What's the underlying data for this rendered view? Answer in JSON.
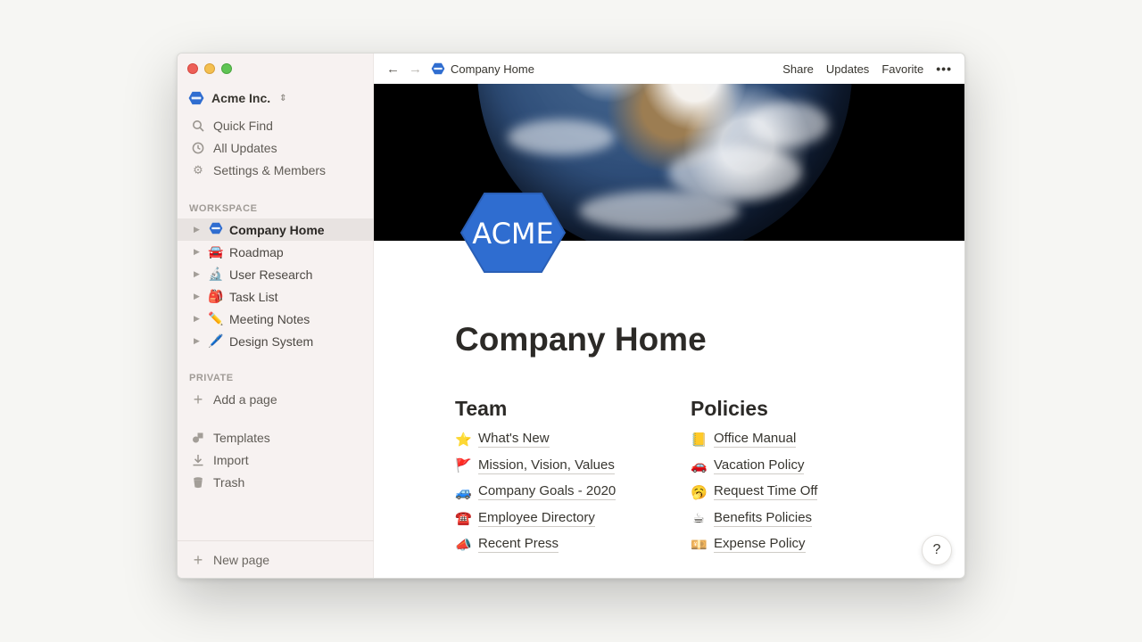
{
  "workspace": {
    "name": "Acme Inc.",
    "chevron": "⌃"
  },
  "nav": [
    {
      "label": "Quick Find",
      "icon": "search-icon",
      "glyph": "⌕"
    },
    {
      "label": "All Updates",
      "icon": "clock-icon",
      "glyph": "◷"
    },
    {
      "label": "Settings & Members",
      "icon": "gear-icon",
      "glyph": "⚙"
    }
  ],
  "sections": {
    "workspace": "WORKSPACE",
    "private": "PRIVATE"
  },
  "pages": [
    {
      "label": "Company Home",
      "emoji": "",
      "active": true
    },
    {
      "label": "Roadmap",
      "emoji": "🚘"
    },
    {
      "label": "User Research",
      "emoji": "🔬"
    },
    {
      "label": "Task List",
      "emoji": "🎒"
    },
    {
      "label": "Meeting Notes",
      "emoji": "✏️"
    },
    {
      "label": "Design System",
      "emoji": "🖊️"
    }
  ],
  "private": {
    "add_page": "Add a page"
  },
  "bottom": [
    {
      "label": "Templates",
      "icon": "templates-icon",
      "glyph": "◭"
    },
    {
      "label": "Import",
      "icon": "download-icon",
      "glyph": "⤓"
    },
    {
      "label": "Trash",
      "icon": "trash-icon",
      "glyph": "◒"
    }
  ],
  "new_page": "New page",
  "topbar": {
    "breadcrumb": "Company Home",
    "share": "Share",
    "updates": "Updates",
    "favorite": "Favorite",
    "more": "•••"
  },
  "logo_text": "ACME",
  "page": {
    "title": "Company Home",
    "team": {
      "heading": "Team",
      "links": [
        {
          "emoji": "⭐",
          "label": "What's New"
        },
        {
          "emoji": "🚩",
          "label": "Mission, Vision, Values"
        },
        {
          "emoji": "🚙",
          "label": "Company Goals - 2020"
        },
        {
          "emoji": "☎️",
          "label": "Employee Directory"
        },
        {
          "emoji": "📣",
          "label": "Recent Press"
        }
      ]
    },
    "policies": {
      "heading": "Policies",
      "links": [
        {
          "emoji": "📒",
          "label": "Office Manual"
        },
        {
          "emoji": "🚗",
          "label": "Vacation Policy"
        },
        {
          "emoji": "🥱",
          "label": "Request Time Off"
        },
        {
          "emoji": "☕",
          "label": "Benefits Policies"
        },
        {
          "emoji": "💴",
          "label": "Expense Policy"
        }
      ]
    }
  },
  "help": "?",
  "colors": {
    "acme_blue": "#2f6dd0",
    "sidebar_bg": "#f7f2f1"
  }
}
